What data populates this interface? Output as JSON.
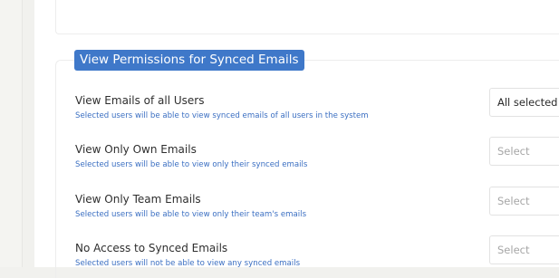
{
  "section": {
    "title": "View Permissions for Synced Emails"
  },
  "permissions": [
    {
      "label": "View Emails of all Users",
      "description": "Selected users will be able to view synced emails of all users in the system",
      "select_value": "All selected"
    },
    {
      "label": "View Only Own Emails",
      "description": "Selected users will be able to view only their synced emails",
      "select_value": "Select"
    },
    {
      "label": "View Only Team Emails",
      "description": "Selected users will be able to view only their team's emails",
      "select_value": "Select"
    },
    {
      "label": "No Access to Synced Emails",
      "description": "Selected users will not be able to view any synced emails",
      "select_value": "Select"
    }
  ],
  "colors": {
    "accent": "#3f78c9",
    "description_text": "#3b6fc2",
    "placeholder_text": "#a6a6a6"
  }
}
